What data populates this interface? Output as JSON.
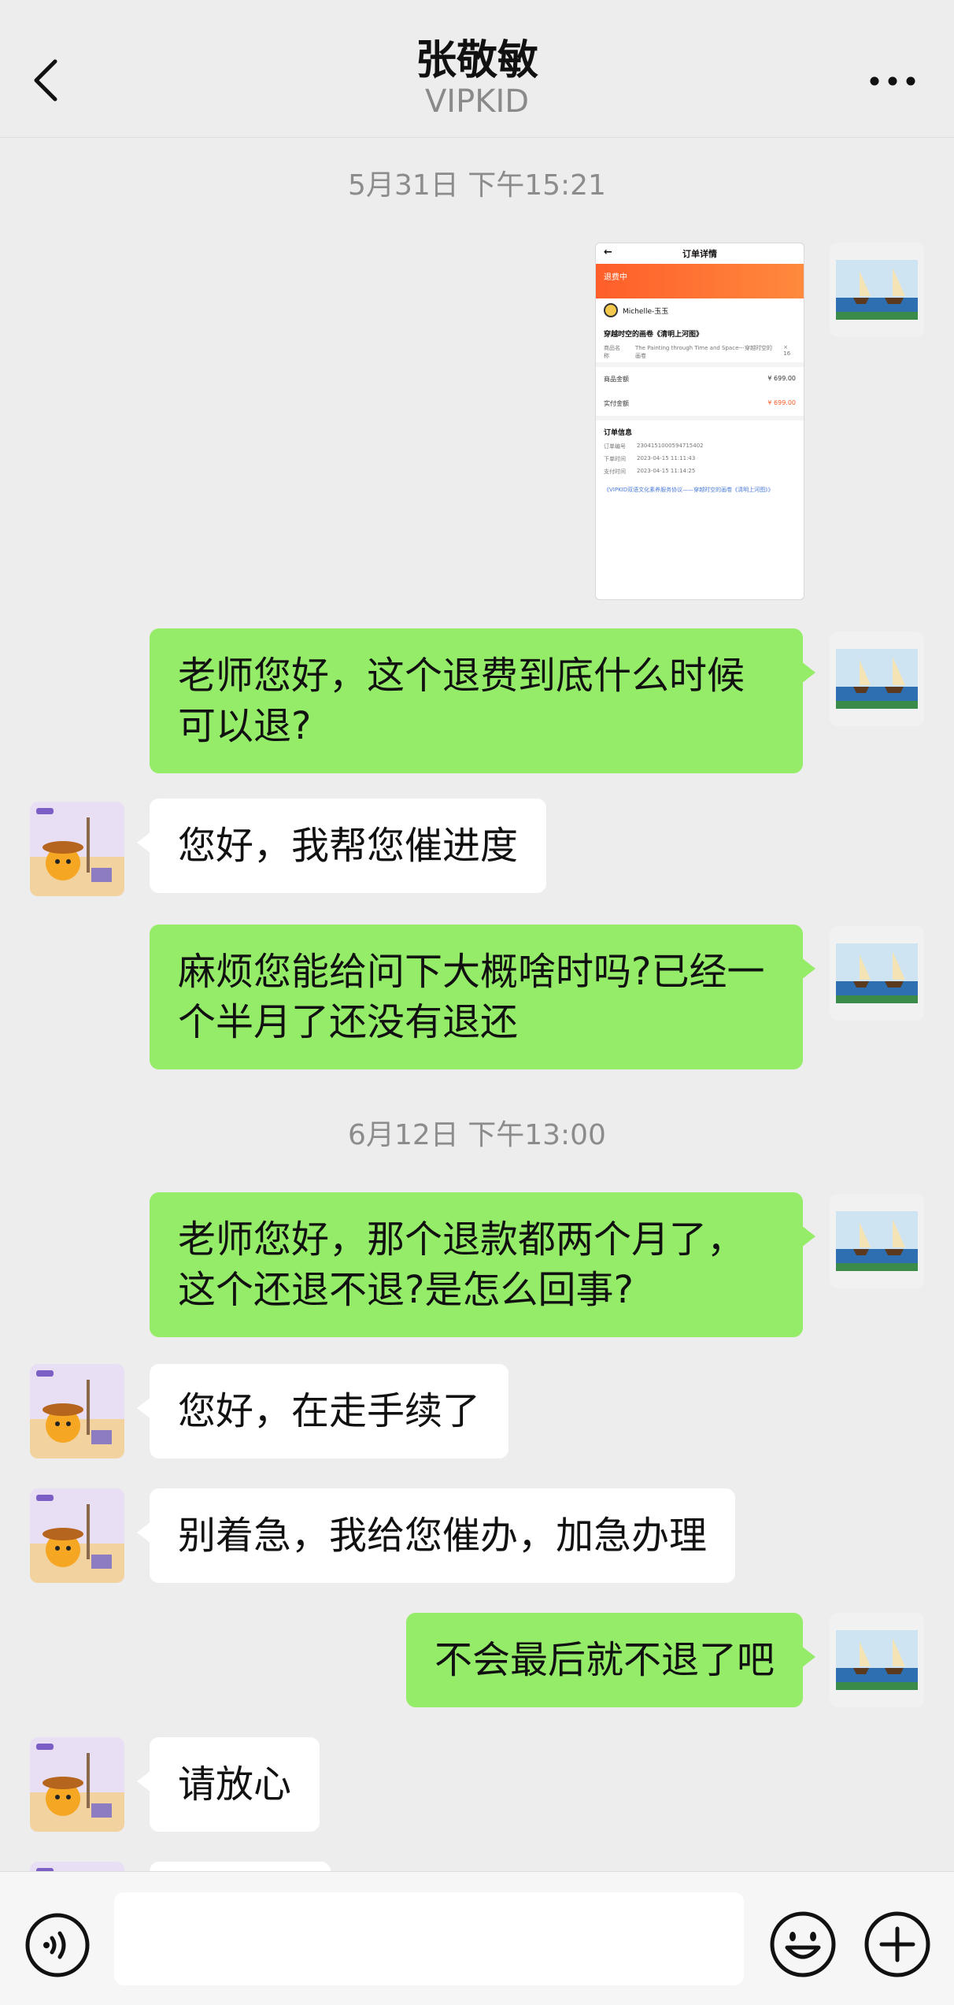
{
  "header": {
    "title": "张敬敏",
    "subtitle": "VIPKID"
  },
  "timestamps": {
    "t1": "5月31日 下午15:21",
    "t2": "6月12日 下午13:00"
  },
  "order_screenshot": {
    "title": "订单详情",
    "status": "退费中",
    "user": "Michelle-玉玉",
    "product_title": "穿越时空的画卷《清明上河图》",
    "product_name_label": "商品名称",
    "product_name_value": "The Painting through Time and Space---穿越时空的画卷",
    "qty": "× 16",
    "amount_label": "商品金额",
    "amount_value": "¥ 699.00",
    "paid_label": "实付金额",
    "paid_value": "¥ 699.00",
    "info_title": "订单信息",
    "order_no_label": "订单编号",
    "order_no": "2304151000594715402",
    "order_time_label": "下单时间",
    "order_time": "2023-04-15 11:11:43",
    "pay_time_label": "支付时间",
    "pay_time": "2023-04-15 11:14:25",
    "agreement": "《VIPKID双语文化素养服务协议——穿越时空的画卷《清明上河图》》"
  },
  "messages": [
    {
      "from": "me",
      "text": "老师您好，这个退费到底什么时候可以退?"
    },
    {
      "from": "them",
      "text": "您好，我帮您催进度"
    },
    {
      "from": "me",
      "text": "麻烦您能给问下大概啥时吗?已经一个半月了还没有退还"
    },
    {
      "from": "me",
      "text": "老师您好，那个退款都两个月了，这个还退不退?是怎么回事?"
    },
    {
      "from": "them",
      "text": "您好，在走手续了"
    },
    {
      "from": "them",
      "text": "别着急，我给您催办，加急办理"
    },
    {
      "from": "me",
      "text": "不会最后就不退了吧"
    },
    {
      "from": "them",
      "text": "请放心"
    }
  ],
  "colors": {
    "my_bubble": "#95ec69",
    "their_bubble": "#ffffff",
    "background": "#ededed"
  }
}
